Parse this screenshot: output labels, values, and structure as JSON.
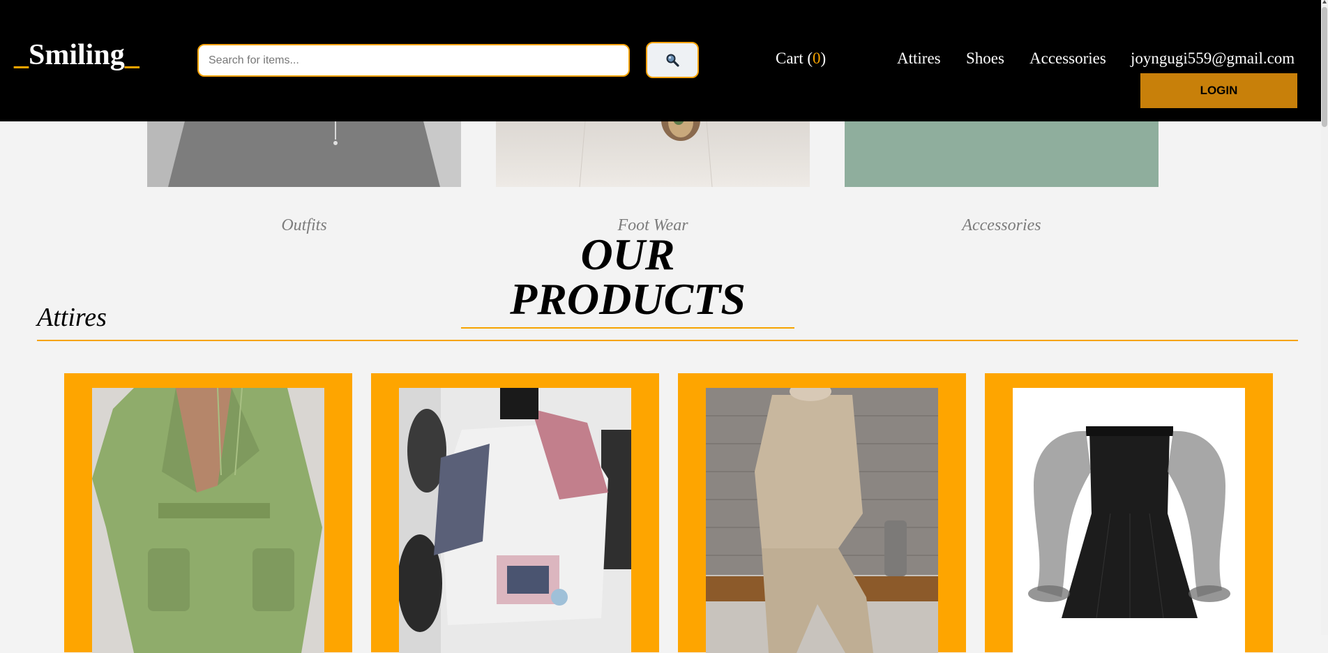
{
  "brand": {
    "prefix": "_",
    "name": "Smiling",
    "suffix": "_"
  },
  "search": {
    "placeholder": "Search for items...",
    "button_icon": "search-icon"
  },
  "cart": {
    "label": "Cart (",
    "count": "0",
    "close": ")"
  },
  "nav": {
    "items": [
      "Attires",
      "Shoes",
      "Accessories"
    ],
    "user_email": "joyngugi559@gmail.com"
  },
  "login": {
    "label": "LOGIN"
  },
  "categories": [
    {
      "label": "Outfits"
    },
    {
      "label": "Foot Wear"
    },
    {
      "label": "Accessories"
    }
  ],
  "products": {
    "heading": "OUR PRODUCTS",
    "section": "Attires",
    "cards": [
      {
        "image": "green hoodie skirt set"
      },
      {
        "image": "pink and navy windbreaker jacket"
      },
      {
        "image": "beige knit sweater set"
      },
      {
        "image": "black off-shoulder dress with sheer sleeves"
      }
    ]
  },
  "colors": {
    "accent": "#f6a300",
    "header_bg": "#000000",
    "login_bg": "#c8800a",
    "card_bg": "#fea500",
    "page_bg": "#f3f3f3"
  }
}
